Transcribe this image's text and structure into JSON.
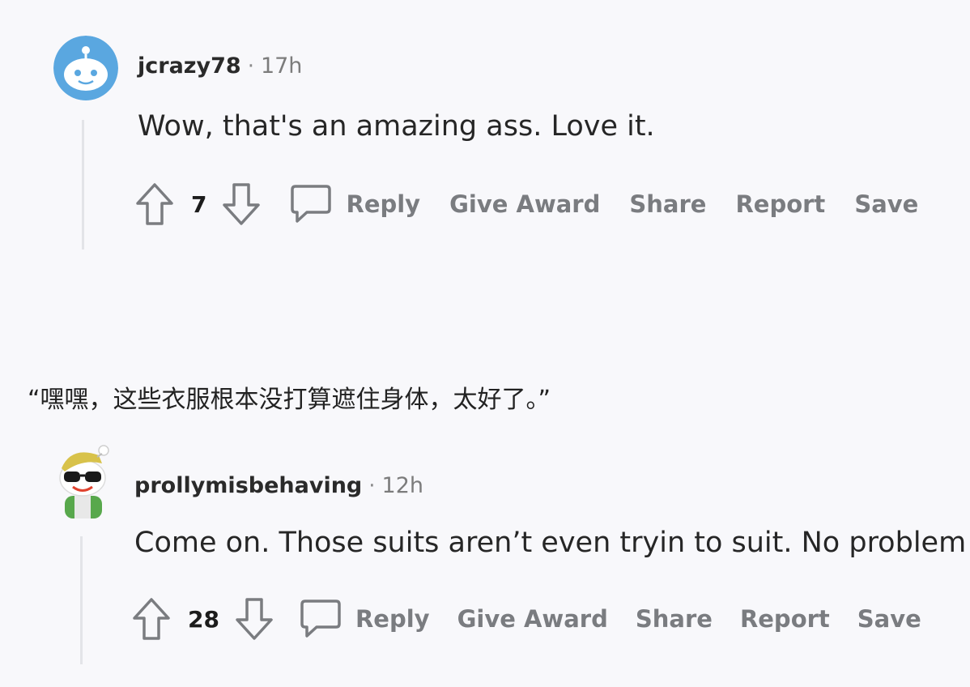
{
  "comments": [
    {
      "username": "jcrazy78",
      "separator": "·",
      "time": "17h",
      "body": "Wow, that's an amazing ass. Love it.",
      "score": "7",
      "actions": {
        "reply": "Reply",
        "give_award": "Give Award",
        "share": "Share",
        "report": "Report",
        "save": "Save"
      },
      "avatar_icon": "snoo-default-avatar"
    },
    {
      "username": "prollymisbehaving",
      "separator": "·",
      "time": "12h",
      "body": "Come on. Those suits aren’t even tryin to suit. No problem",
      "score": "28",
      "actions": {
        "reply": "Reply",
        "give_award": "Give Award",
        "share": "Share",
        "report": "Report",
        "save": "Save"
      },
      "avatar_icon": "snoo-sunglasses-avatar"
    }
  ],
  "caption": "“嘿嘿，这些衣服根本没打算遮住身体，太好了。”",
  "colors": {
    "background": "#f8f8fb",
    "action_gray": "#7a7c80",
    "thread_line": "#e3e4e8",
    "avatar_blue": "#5aa7e0"
  }
}
